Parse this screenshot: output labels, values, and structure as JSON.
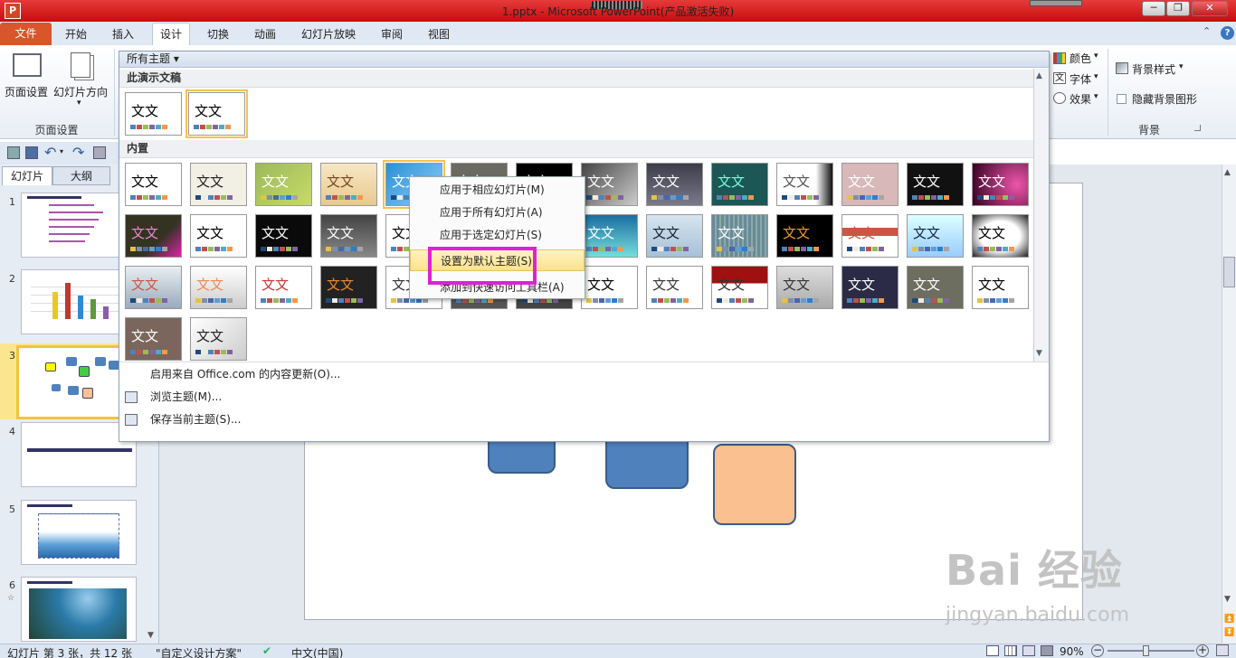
{
  "window": {
    "title": "1.pptx - Microsoft PowerPoint(产品激活失败)",
    "app_icon": "P",
    "minimize": "─",
    "restore": "❐",
    "close": "✕"
  },
  "ribbon_tabs": [
    "文件",
    "开始",
    "插入",
    "设计",
    "切换",
    "动画",
    "幻灯片放映",
    "审阅",
    "视图"
  ],
  "active_tab": "设计",
  "help": "?",
  "ribbon": {
    "page_setup": "页面设置",
    "slide_orientation": "幻灯片方向",
    "group_page_setup": "页面设置",
    "colors": "颜色",
    "fonts": "字体",
    "effects": "效果",
    "background_styles": "背景样式",
    "hide_background": "隐藏背景图形",
    "group_background": "背景"
  },
  "left_pane": {
    "tab_slides": "幻灯片",
    "tab_outline": "大纲",
    "slide_numbers": [
      "1",
      "2",
      "3",
      "4",
      "5",
      "6"
    ],
    "selected_slide": 3
  },
  "theme_gallery": {
    "header": "所有主题 ▾",
    "section_this": "此演示文稿",
    "section_builtin": "内置",
    "sample_text": "文文",
    "sample_text_alt": "文文",
    "footer_items": [
      "启用来自 Office.com 的内容更新(O)...",
      "浏览主题(M)...",
      "保存当前主题(S)..."
    ]
  },
  "context_menu": {
    "items": [
      "应用于相应幻灯片(M)",
      "应用于所有幻灯片(A)",
      "应用于选定幻灯片(S)",
      "设置为默认主题(S)",
      "添加到快速访问工具栏(A)"
    ],
    "highlighted": "设置为默认主题(S)"
  },
  "status_bar": {
    "slide_info": "幻灯片 第 3 张，共 12 张",
    "theme_name": "\"自定义设计方案\"",
    "language": "中文(中国)",
    "zoom": "90%",
    "zoom_minus": "−",
    "zoom_plus": "+"
  },
  "watermark": {
    "brand": "Bai 经验",
    "url": "jingyan.baidu.com"
  },
  "colors": {
    "title_red": "#d00000",
    "file_tab": "#d9552b",
    "highlight_magenta": "#e020d8",
    "shape_blue": "#4f81bd",
    "shape_orange": "#fac090"
  }
}
